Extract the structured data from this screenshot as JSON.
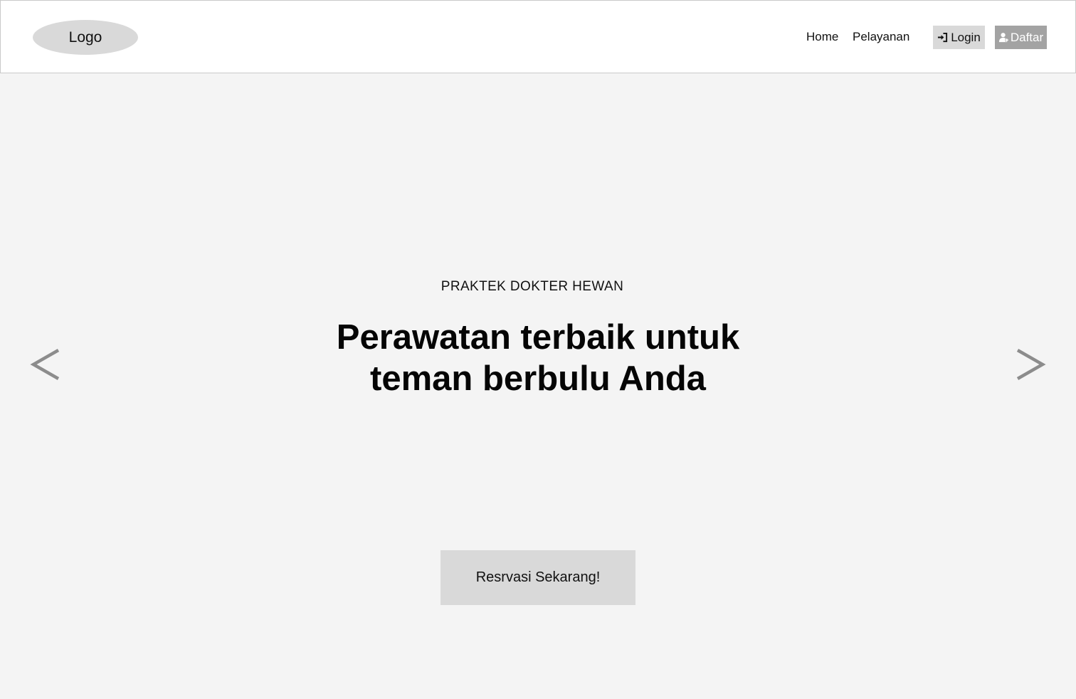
{
  "header": {
    "logo_text": "Logo",
    "nav": {
      "home": "Home",
      "services": "Pelayanan"
    },
    "login_label": "Login",
    "register_label": "Daftar",
    "login_icon": "sign-in-icon",
    "register_icon": "user-add-icon"
  },
  "hero": {
    "eyebrow": "PRAKTEK DOKTER HEWAN",
    "title": "Perawatan terbaik untuk teman berbulu Anda",
    "prev_icon": "chevron-left-icon",
    "next_icon": "chevron-right-icon",
    "cta_label": "Resrvasi Sekarang!"
  },
  "colors": {
    "background": "#f4f4f4",
    "header_bg": "#ffffff",
    "placeholder_gray": "#d9d9d9",
    "register_bg": "#a3a3a3",
    "arrow_gray": "#8c8c8c"
  }
}
